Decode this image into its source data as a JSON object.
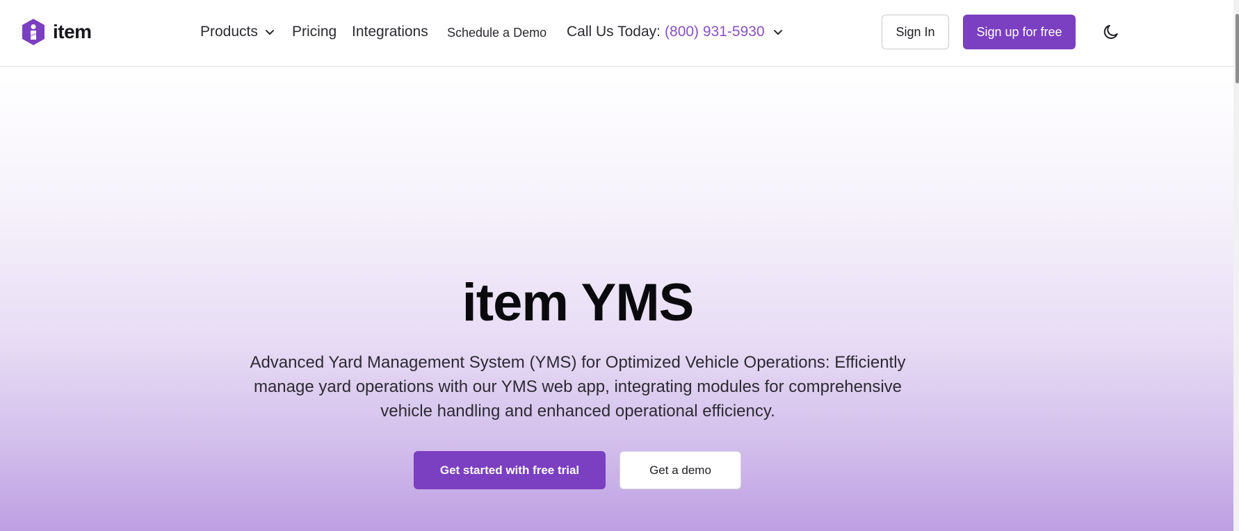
{
  "brand": {
    "name": "item",
    "logo_icon": "hexagon-logo-icon",
    "accent_color": "#7b3fc1",
    "phone_color": "#8a4fc4"
  },
  "nav": {
    "products": "Products",
    "pricing": "Pricing",
    "integrations": "Integrations",
    "schedule_demo": "Schedule a Demo",
    "call_label": "Call Us Today:",
    "call_phone": "(800) 931-5930"
  },
  "header_actions": {
    "sign_in": "Sign In",
    "sign_up": "Sign up for free",
    "theme_icon": "moon-icon"
  },
  "hero": {
    "title": "item YMS",
    "description": "Advanced Yard Management System (YMS) for Optimized Vehicle Operations: Efficiently manage yard operations with our YMS web app, integrating modules for comprehensive vehicle handling and enhanced operational efficiency.",
    "primary_cta": "Get started with free trial",
    "secondary_cta": "Get a demo"
  }
}
